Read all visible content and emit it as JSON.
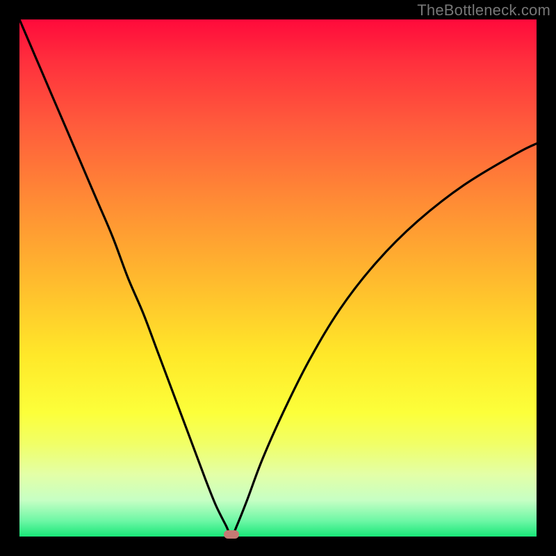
{
  "watermark": "TheBottleneck.com",
  "colors": {
    "frame": "#000000",
    "gradient_top": "#ff0a3b",
    "gradient_bottom": "#18e778",
    "curve": "#000000",
    "marker": "#c57a74",
    "watermark": "#777777"
  },
  "chart_data": {
    "type": "line",
    "title": "",
    "xlabel": "",
    "ylabel": "",
    "xlim": [
      0,
      100
    ],
    "ylim": [
      0,
      100
    ],
    "grid": false,
    "legend": false,
    "note": "Axis values are estimated from pixel positions; v-shaped bottleneck curve with minimum near x≈41.",
    "series": [
      {
        "name": "bottleneck-curve",
        "x": [
          0,
          3,
          6,
          9,
          12,
          15,
          18,
          21,
          24,
          27,
          30,
          33,
          36,
          38,
          40,
          41,
          42,
          44,
          47,
          51,
          56,
          62,
          69,
          77,
          86,
          96,
          100
        ],
        "y": [
          100,
          93,
          86,
          79,
          72,
          65,
          58,
          50,
          43,
          35,
          27,
          19,
          11,
          6,
          2,
          0,
          2,
          7,
          15,
          24,
          34,
          44,
          53,
          61,
          68,
          74,
          76
        ]
      }
    ],
    "marker": {
      "x": 41,
      "y": 0,
      "shape": "rounded-rect"
    }
  }
}
